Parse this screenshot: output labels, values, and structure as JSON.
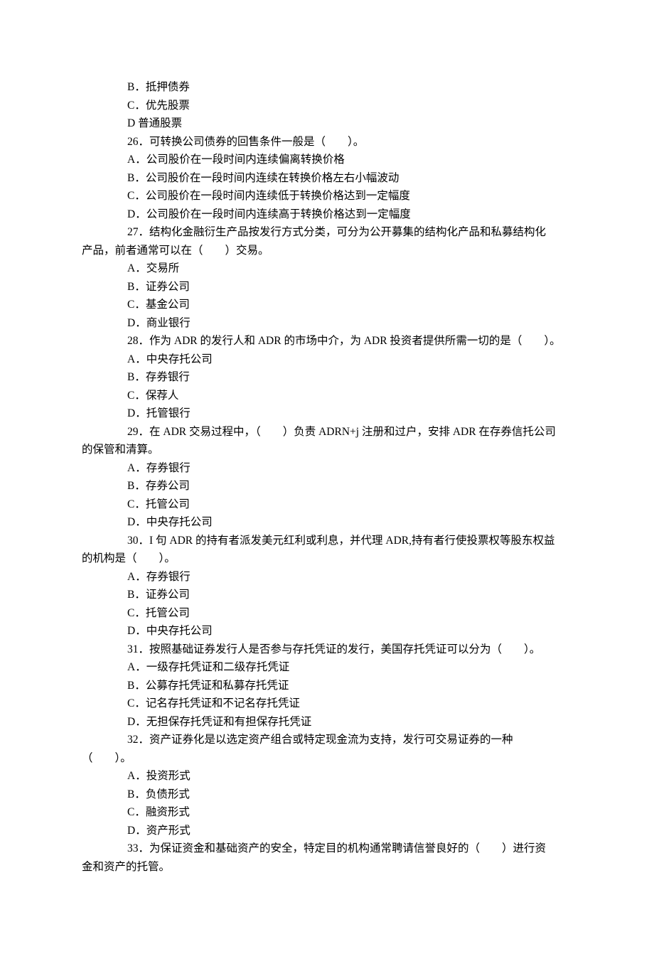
{
  "lines": [
    {
      "cls": "option",
      "text": "B．抵押债券"
    },
    {
      "cls": "option",
      "text": "C．优先股票"
    },
    {
      "cls": "option",
      "text": "D 普通股票"
    },
    {
      "cls": "question",
      "text": "26．可转换公司债券的回售条件一般是（　　）。"
    },
    {
      "cls": "option",
      "text": "A．公司股价在一段时间内连续偏离转换价格"
    },
    {
      "cls": "option",
      "text": "B．公司股价在一段时间内连续在转换价格左右小幅波动"
    },
    {
      "cls": "option",
      "text": "C．公司股价在一段时间内连续低于转换价格达到一定幅度"
    },
    {
      "cls": "option",
      "text": "D．公司股价在一段时间内连续高于转换价格达到一定幅度"
    },
    {
      "cls": "question",
      "text": "27．结构化金融衍生产品按发行方式分类，可分为公开募集的结构化产品和私募结构化"
    },
    {
      "cls": "cont",
      "text": "产品，前者通常可以在（　　）交易。"
    },
    {
      "cls": "option",
      "text": "A．交易所"
    },
    {
      "cls": "option",
      "text": "B．证券公司"
    },
    {
      "cls": "option",
      "text": "C．基金公司"
    },
    {
      "cls": "option",
      "text": "D．商业银行"
    },
    {
      "cls": "question",
      "text": "28．作为 ADR 的发行人和 ADR 的市场中介，为 ADR 投资者提供所需一切的是（　　）。"
    },
    {
      "cls": "option",
      "text": "A．中央存托公司"
    },
    {
      "cls": "option",
      "text": "B．存券银行"
    },
    {
      "cls": "option",
      "text": "C．保荐人"
    },
    {
      "cls": "option",
      "text": "D．托管银行"
    },
    {
      "cls": "question",
      "text": "29．在 ADR 交易过程中，（　　）负责 ADRN+j 注册和过户，安排 ADR 在存券信托公司"
    },
    {
      "cls": "cont",
      "text": "的保管和清算。"
    },
    {
      "cls": "option",
      "text": "A．存券银行"
    },
    {
      "cls": "option",
      "text": "B．存券公司"
    },
    {
      "cls": "option",
      "text": "C．托管公司"
    },
    {
      "cls": "option",
      "text": "D．中央存托公司"
    },
    {
      "cls": "question",
      "text": "30．I 句 ADR 的持有者派发美元红利或利息，并代理 ADR,持有者行使投票权等股东权益"
    },
    {
      "cls": "cont",
      "text": "的机构是（　　）。"
    },
    {
      "cls": "option",
      "text": "A．存券银行"
    },
    {
      "cls": "option",
      "text": "B．证券公司"
    },
    {
      "cls": "option",
      "text": "C．托管公司"
    },
    {
      "cls": "option",
      "text": "D．中央存托公司"
    },
    {
      "cls": "question",
      "text": "31．按照基础证券发行人是否参与存托凭证的发行，美国存托凭证可以分为（　　）。"
    },
    {
      "cls": "option",
      "text": "A．一级存托凭证和二级存托凭证"
    },
    {
      "cls": "option",
      "text": "B．公募存托凭证和私募存托凭证"
    },
    {
      "cls": "option",
      "text": "C．记名存托凭证和不记名存托凭证"
    },
    {
      "cls": "option",
      "text": "D．无担保存托凭证和有担保存托凭证"
    },
    {
      "cls": "question",
      "text": "32．资产证券化是以选定资产组合或特定现金流为支持，发行可交易证券的一种"
    },
    {
      "cls": "cont",
      "text": "（　　）。"
    },
    {
      "cls": "option",
      "text": "A．投资形式"
    },
    {
      "cls": "option",
      "text": "B．负债形式"
    },
    {
      "cls": "option",
      "text": "C．融资形式"
    },
    {
      "cls": "option",
      "text": "D．资产形式"
    },
    {
      "cls": "question",
      "text": "33．为保证资金和基础资产的安全，特定目的机构通常聘请信誉良好的（　　）进行资"
    },
    {
      "cls": "cont",
      "text": "金和资产的托管。"
    }
  ]
}
